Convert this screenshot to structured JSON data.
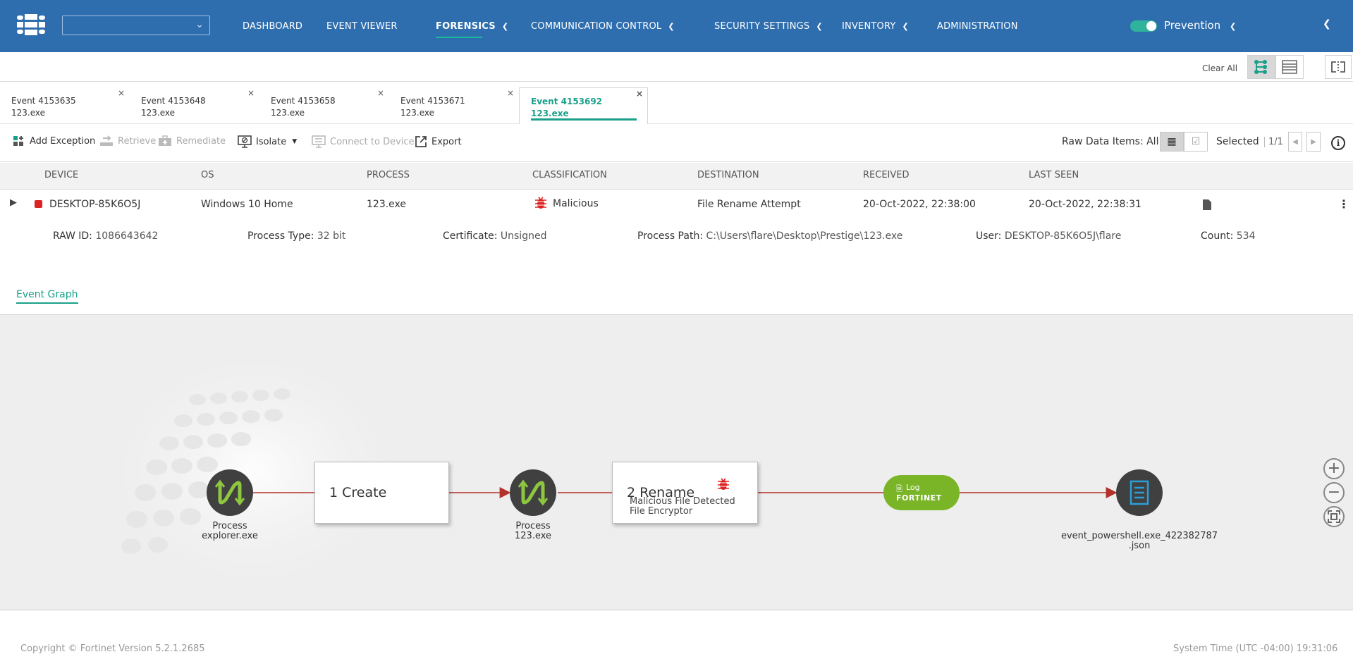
{
  "nav": {
    "items": [
      {
        "label": "DASHBOARD"
      },
      {
        "label": "EVENT VIEWER"
      },
      {
        "label": "FORENSICS"
      },
      {
        "label": "COMMUNICATION CONTROL"
      },
      {
        "label": "SECURITY SETTINGS"
      },
      {
        "label": "INVENTORY"
      },
      {
        "label": "ADMINISTRATION"
      }
    ],
    "active": "FORENSICS",
    "mode_label": "Prevention",
    "toggle_on": true,
    "brand_color": "#2f6eae",
    "accent_color": "#1aa08a"
  },
  "subbar": {
    "clear_all": "Clear All"
  },
  "tabs": [
    {
      "event": "Event 4153635",
      "process": "123.exe"
    },
    {
      "event": "Event 4153648",
      "process": "123.exe"
    },
    {
      "event": "Event 4153658",
      "process": "123.exe"
    },
    {
      "event": "Event 4153671",
      "process": "123.exe"
    },
    {
      "event": "Event 4153692",
      "process": "123.exe"
    }
  ],
  "toolbar": {
    "add_exception": "Add Exception",
    "retrieve": "Retrieve",
    "remediate": "Remediate",
    "isolate": "Isolate",
    "connect": "Connect to Device",
    "export": "Export",
    "raw_data": "Raw Data Items: All",
    "selected": "Selected",
    "pager": "1/1"
  },
  "table": {
    "headers": [
      "DEVICE",
      "OS",
      "PROCESS",
      "CLASSIFICATION",
      "DESTINATION",
      "RECEIVED",
      "LAST SEEN"
    ],
    "row": {
      "device": "DESKTOP-85K6O5J",
      "os": "Windows 10 Home",
      "process": "123.exe",
      "classification": "Malicious",
      "destination": "File Rename Attempt",
      "received": "20-Oct-2022, 22:38:00",
      "last_seen": "20-Oct-2022, 22:38:31"
    },
    "details": {
      "raw_id_label": "RAW ID:",
      "raw_id": "1086643642",
      "process_type_label": "Process Type:",
      "process_type": "32 bit",
      "certificate_label": "Certificate:",
      "certificate": "Unsigned",
      "process_path_label": "Process Path:",
      "process_path": "C:\\Users\\flare\\Desktop\\Prestige\\123.exe",
      "user_label": "User:",
      "user": "DESKTOP-85K6O5J\\flare",
      "count_label": "Count:",
      "count": "534"
    }
  },
  "graph": {
    "tab_label": "Event Graph",
    "node1": {
      "line1": "Process",
      "line2": "explorer.exe"
    },
    "action1": "1 Create",
    "node2": {
      "line1": "Process",
      "line2": "123.exe"
    },
    "action2": {
      "title": "2 Rename",
      "line1": "Malicious File Detected",
      "line2": "File Encryptor"
    },
    "log_label": "Log",
    "log_brand": "FORTINET",
    "node3": {
      "line1": "event_powershell.exe_422382787",
      "line2": ".json"
    }
  },
  "footer": {
    "copyright": "Copyright © Fortinet Version 5.2.1.2685",
    "system_time": "System Time (UTC -04:00) 19:31:06"
  }
}
